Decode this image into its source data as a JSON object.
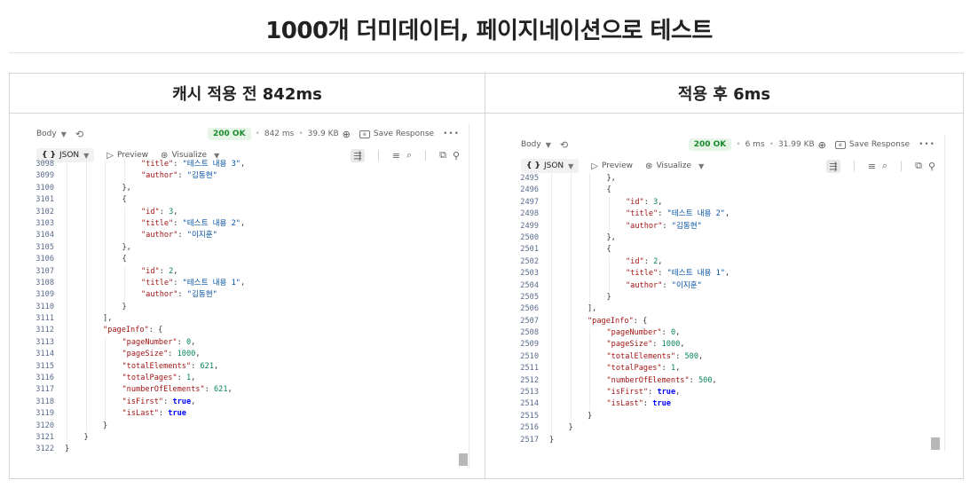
{
  "page": {
    "title": "1000개 더미데이터, 페이지네이션으로 테스트"
  },
  "columns": [
    {
      "header": "캐시 적용 전 842ms",
      "response": {
        "body_label": "Body",
        "status": "200 OK",
        "time": "842 ms",
        "size": "39.9 KB",
        "save_label": "Save Response"
      },
      "toolbar": {
        "format": "JSON",
        "preview": "Preview",
        "visualize": "Visualize"
      },
      "code_lines": [
        {
          "no": "3098",
          "indent": 4,
          "parts": [
            [
              "k",
              "\"title\""
            ],
            [
              "t",
              ": "
            ],
            [
              "s",
              "\"테스트 내용 3\""
            ],
            [
              "t",
              ","
            ]
          ]
        },
        {
          "no": "3099",
          "indent": 4,
          "parts": [
            [
              "k",
              "\"author\""
            ],
            [
              "t",
              ": "
            ],
            [
              "s",
              "\"김동현\""
            ]
          ]
        },
        {
          "no": "3100",
          "indent": 3,
          "parts": [
            [
              "t",
              "},"
            ]
          ]
        },
        {
          "no": "3101",
          "indent": 3,
          "parts": [
            [
              "t",
              "{"
            ]
          ]
        },
        {
          "no": "3102",
          "indent": 4,
          "parts": [
            [
              "k",
              "\"id\""
            ],
            [
              "t",
              ": "
            ],
            [
              "n",
              "3"
            ],
            [
              "t",
              ","
            ]
          ]
        },
        {
          "no": "3103",
          "indent": 4,
          "parts": [
            [
              "k",
              "\"title\""
            ],
            [
              "t",
              ": "
            ],
            [
              "s",
              "\"테스트 내용 2\""
            ],
            [
              "t",
              ","
            ]
          ]
        },
        {
          "no": "3104",
          "indent": 4,
          "parts": [
            [
              "k",
              "\"author\""
            ],
            [
              "t",
              ": "
            ],
            [
              "s",
              "\"이지훈\""
            ]
          ]
        },
        {
          "no": "3105",
          "indent": 3,
          "parts": [
            [
              "t",
              "},"
            ]
          ]
        },
        {
          "no": "3106",
          "indent": 3,
          "parts": [
            [
              "t",
              "{"
            ]
          ]
        },
        {
          "no": "3107",
          "indent": 4,
          "parts": [
            [
              "k",
              "\"id\""
            ],
            [
              "t",
              ": "
            ],
            [
              "n",
              "2"
            ],
            [
              "t",
              ","
            ]
          ]
        },
        {
          "no": "3108",
          "indent": 4,
          "parts": [
            [
              "k",
              "\"title\""
            ],
            [
              "t",
              ": "
            ],
            [
              "s",
              "\"테스트 내용 1\""
            ],
            [
              "t",
              ","
            ]
          ]
        },
        {
          "no": "3109",
          "indent": 4,
          "parts": [
            [
              "k",
              "\"author\""
            ],
            [
              "t",
              ": "
            ],
            [
              "s",
              "\"김동현\""
            ]
          ]
        },
        {
          "no": "3110",
          "indent": 3,
          "parts": [
            [
              "t",
              "}"
            ]
          ]
        },
        {
          "no": "3111",
          "indent": 2,
          "parts": [
            [
              "t",
              "],"
            ]
          ]
        },
        {
          "no": "3112",
          "indent": 2,
          "parts": [
            [
              "k",
              "\"pageInfo\""
            ],
            [
              "t",
              ": {"
            ]
          ]
        },
        {
          "no": "3113",
          "indent": 3,
          "parts": [
            [
              "k",
              "\"pageNumber\""
            ],
            [
              "t",
              ": "
            ],
            [
              "n",
              "0"
            ],
            [
              "t",
              ","
            ]
          ]
        },
        {
          "no": "3114",
          "indent": 3,
          "parts": [
            [
              "k",
              "\"pageSize\""
            ],
            [
              "t",
              ": "
            ],
            [
              "n",
              "1000"
            ],
            [
              "t",
              ","
            ]
          ]
        },
        {
          "no": "3115",
          "indent": 3,
          "parts": [
            [
              "k",
              "\"totalElements\""
            ],
            [
              "t",
              ": "
            ],
            [
              "n",
              "621"
            ],
            [
              "t",
              ","
            ]
          ]
        },
        {
          "no": "3116",
          "indent": 3,
          "parts": [
            [
              "k",
              "\"totalPages\""
            ],
            [
              "t",
              ": "
            ],
            [
              "n",
              "1"
            ],
            [
              "t",
              ","
            ]
          ]
        },
        {
          "no": "3117",
          "indent": 3,
          "parts": [
            [
              "k",
              "\"numberOfElements\""
            ],
            [
              "t",
              ": "
            ],
            [
              "n",
              "621"
            ],
            [
              "t",
              ","
            ]
          ]
        },
        {
          "no": "3118",
          "indent": 3,
          "parts": [
            [
              "k",
              "\"isFirst\""
            ],
            [
              "t",
              ": "
            ],
            [
              "b",
              "true"
            ],
            [
              "t",
              ","
            ]
          ]
        },
        {
          "no": "3119",
          "indent": 3,
          "parts": [
            [
              "k",
              "\"isLast\""
            ],
            [
              "t",
              ": "
            ],
            [
              "b",
              "true"
            ]
          ]
        },
        {
          "no": "3120",
          "indent": 2,
          "parts": [
            [
              "t",
              "}"
            ]
          ]
        },
        {
          "no": "3121",
          "indent": 1,
          "parts": [
            [
              "t",
              "}"
            ]
          ]
        },
        {
          "no": "3122",
          "indent": 0,
          "parts": [
            [
              "t",
              "}"
            ]
          ]
        }
      ]
    },
    {
      "header": "적용 후 6ms",
      "response": {
        "body_label": "Body",
        "status": "200 OK",
        "time": "6 ms",
        "size": "31.99 KB",
        "save_label": "Save Response"
      },
      "toolbar": {
        "format": "JSON",
        "preview": "Preview",
        "visualize": "Visualize"
      },
      "code_lines": [
        {
          "no": "2495",
          "indent": 3,
          "parts": [
            [
              "t",
              "},"
            ]
          ]
        },
        {
          "no": "2496",
          "indent": 3,
          "parts": [
            [
              "t",
              "{"
            ]
          ]
        },
        {
          "no": "2497",
          "indent": 4,
          "parts": [
            [
              "k",
              "\"id\""
            ],
            [
              "t",
              ": "
            ],
            [
              "n",
              "3"
            ],
            [
              "t",
              ","
            ]
          ]
        },
        {
          "no": "2498",
          "indent": 4,
          "parts": [
            [
              "k",
              "\"title\""
            ],
            [
              "t",
              ": "
            ],
            [
              "s",
              "\"테스트 내용 2\""
            ],
            [
              "t",
              ","
            ]
          ]
        },
        {
          "no": "2499",
          "indent": 4,
          "parts": [
            [
              "k",
              "\"author\""
            ],
            [
              "t",
              ": "
            ],
            [
              "s",
              "\"김동현\""
            ]
          ]
        },
        {
          "no": "2500",
          "indent": 3,
          "parts": [
            [
              "t",
              "},"
            ]
          ]
        },
        {
          "no": "2501",
          "indent": 3,
          "parts": [
            [
              "t",
              "{"
            ]
          ]
        },
        {
          "no": "2502",
          "indent": 4,
          "parts": [
            [
              "k",
              "\"id\""
            ],
            [
              "t",
              ": "
            ],
            [
              "n",
              "2"
            ],
            [
              "t",
              ","
            ]
          ]
        },
        {
          "no": "2503",
          "indent": 4,
          "parts": [
            [
              "k",
              "\"title\""
            ],
            [
              "t",
              ": "
            ],
            [
              "s",
              "\"테스트 내용 1\""
            ],
            [
              "t",
              ","
            ]
          ]
        },
        {
          "no": "2504",
          "indent": 4,
          "parts": [
            [
              "k",
              "\"author\""
            ],
            [
              "t",
              ": "
            ],
            [
              "s",
              "\"이지훈\""
            ]
          ]
        },
        {
          "no": "2505",
          "indent": 3,
          "parts": [
            [
              "t",
              "}"
            ]
          ]
        },
        {
          "no": "2506",
          "indent": 2,
          "parts": [
            [
              "t",
              "],"
            ]
          ]
        },
        {
          "no": "2507",
          "indent": 2,
          "parts": [
            [
              "k",
              "\"pageInfo\""
            ],
            [
              "t",
              ": {"
            ]
          ]
        },
        {
          "no": "2508",
          "indent": 3,
          "parts": [
            [
              "k",
              "\"pageNumber\""
            ],
            [
              "t",
              ": "
            ],
            [
              "n",
              "0"
            ],
            [
              "t",
              ","
            ]
          ]
        },
        {
          "no": "2509",
          "indent": 3,
          "parts": [
            [
              "k",
              "\"pageSize\""
            ],
            [
              "t",
              ": "
            ],
            [
              "n",
              "1000"
            ],
            [
              "t",
              ","
            ]
          ]
        },
        {
          "no": "2510",
          "indent": 3,
          "parts": [
            [
              "k",
              "\"totalElements\""
            ],
            [
              "t",
              ": "
            ],
            [
              "n",
              "500"
            ],
            [
              "t",
              ","
            ]
          ]
        },
        {
          "no": "2511",
          "indent": 3,
          "parts": [
            [
              "k",
              "\"totalPages\""
            ],
            [
              "t",
              ": "
            ],
            [
              "n",
              "1"
            ],
            [
              "t",
              ","
            ]
          ]
        },
        {
          "no": "2512",
          "indent": 3,
          "parts": [
            [
              "k",
              "\"numberOfElements\""
            ],
            [
              "t",
              ": "
            ],
            [
              "n",
              "500"
            ],
            [
              "t",
              ","
            ]
          ]
        },
        {
          "no": "2513",
          "indent": 3,
          "parts": [
            [
              "k",
              "\"isFirst\""
            ],
            [
              "t",
              ": "
            ],
            [
              "b",
              "true"
            ],
            [
              "t",
              ","
            ]
          ]
        },
        {
          "no": "2514",
          "indent": 3,
          "parts": [
            [
              "k",
              "\"isLast\""
            ],
            [
              "t",
              ": "
            ],
            [
              "b",
              "true"
            ]
          ]
        },
        {
          "no": "2515",
          "indent": 2,
          "parts": [
            [
              "t",
              "}"
            ]
          ]
        },
        {
          "no": "2516",
          "indent": 1,
          "parts": [
            [
              "t",
              "}"
            ]
          ]
        },
        {
          "no": "2517",
          "indent": 0,
          "parts": [
            [
              "t",
              "}"
            ]
          ]
        }
      ]
    }
  ]
}
